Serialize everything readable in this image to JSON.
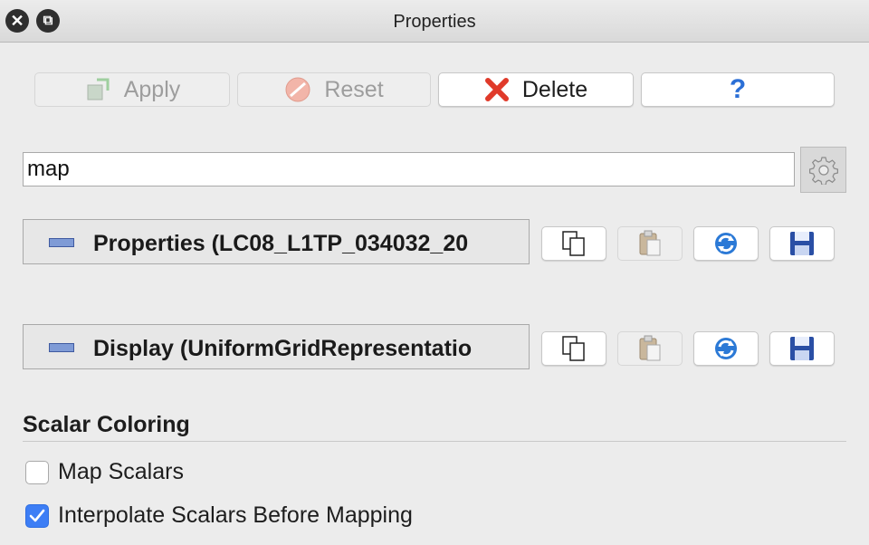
{
  "window": {
    "title": "Properties",
    "close_icon": "close-icon",
    "float_icon": "float-icon"
  },
  "toolbar": {
    "apply_label": "Apply",
    "reset_label": "Reset",
    "delete_label": "Delete",
    "help_label": "?"
  },
  "search": {
    "value": "map"
  },
  "sections": [
    {
      "label": "Properties (LC08_L1TP_034032_20"
    },
    {
      "label": "Display (UniformGridRepresentatio"
    }
  ],
  "scalar_coloring": {
    "title": "Scalar Coloring",
    "map_scalars_label": "Map Scalars",
    "map_scalars_checked": false,
    "interpolate_label": "Interpolate Scalars Before Mapping",
    "interpolate_checked": true
  },
  "colors": {
    "accent": "#3d7ef5",
    "delete_red": "#e03a2a",
    "help_blue": "#2b6fd6"
  }
}
